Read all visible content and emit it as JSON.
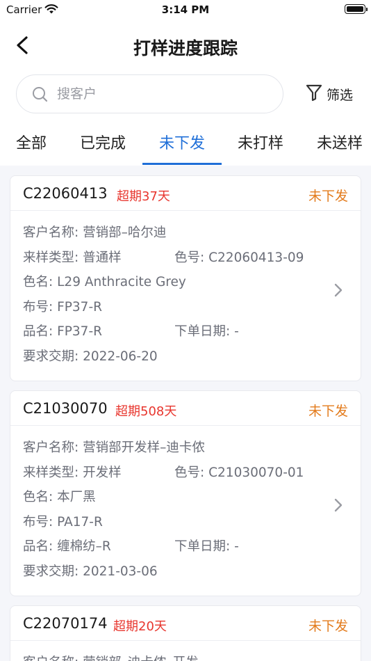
{
  "status_bar": {
    "carrier": "Carrier",
    "time": "3:14 PM"
  },
  "header": {
    "title": "打样进度跟踪"
  },
  "search": {
    "placeholder": "搜客户"
  },
  "filter": {
    "label": "筛选"
  },
  "tabs": [
    {
      "label": "全部"
    },
    {
      "label": "已完成"
    },
    {
      "label": "未下发"
    },
    {
      "label": "未打样"
    },
    {
      "label": "未送样"
    }
  ],
  "active_tab": "未下发",
  "colors": {
    "accent": "#1f6fd8",
    "overdue": "#e8362e",
    "status": "#e37b1c"
  },
  "cards": [
    {
      "code": "C22060413",
      "overdue": "超期37天",
      "status": "未下发",
      "customer": "客户名称: 营销部–哈尔迪",
      "sample_type": "来样类型: 普通样",
      "color_no": "色号: C22060413-09",
      "color_name": "色名: L29 Anthracite Grey",
      "cloth_no": "布号: FP37-R",
      "product": "品名: FP37-R",
      "order_date": "下单日期: -",
      "due_date": "要求交期: 2022-06-20"
    },
    {
      "code": "C21030070",
      "overdue": "超期508天",
      "status": "未下发",
      "customer": "客户名称: 营销部开发样–迪卡侬",
      "sample_type": "来样类型: 开发样",
      "color_no": "色号: C21030070-01",
      "color_name": "色名: 本厂黑",
      "cloth_no": "布号: PA17-R",
      "product": "品名: 缠棉纺–R",
      "order_date": "下单日期: -",
      "due_date": "要求交期: 2021-03-06"
    },
    {
      "code": "C22070174",
      "overdue": "超期20天",
      "status": "未下发",
      "customer": "客户名称: 营销部–迪卡侬–开发"
    }
  ]
}
